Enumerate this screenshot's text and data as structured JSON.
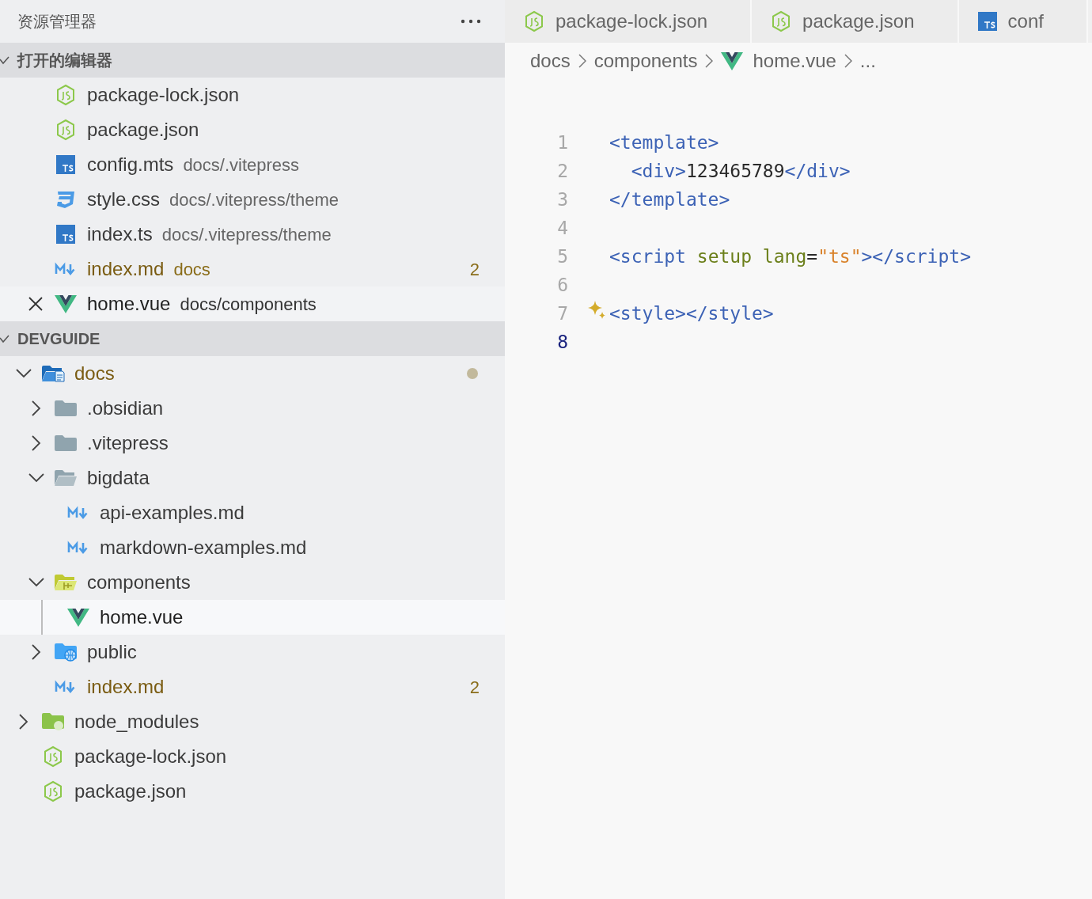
{
  "sidebar": {
    "title": "资源管理器",
    "sections": [
      {
        "title": "打开的编辑器",
        "expanded": true,
        "kind": "editors",
        "items": [
          {
            "name": "package-lock.json",
            "kind": "json",
            "modified": false,
            "selected": false
          },
          {
            "name": "package.json",
            "kind": "json",
            "modified": false,
            "selected": false
          },
          {
            "name": "config.mts",
            "path": "docs/.vitepress",
            "kind": "ts",
            "modified": false,
            "selected": false
          },
          {
            "name": "style.css",
            "path": "docs/.vitepress/theme",
            "kind": "css",
            "modified": false,
            "selected": false
          },
          {
            "name": "index.ts",
            "path": "docs/.vitepress/theme",
            "kind": "ts",
            "modified": false,
            "selected": false
          },
          {
            "name": "index.md",
            "path": "docs",
            "kind": "md",
            "modified": true,
            "badge": "2",
            "selected": false
          },
          {
            "name": "home.vue",
            "path": "docs/components",
            "kind": "vue",
            "modified": false,
            "selected": true
          }
        ]
      },
      {
        "title": "DEVGUIDE",
        "expanded": true,
        "kind": "tree",
        "items": [
          {
            "kind": "docs-folder",
            "name": "docs",
            "expanded": true,
            "modified": true,
            "dot": true,
            "selected": false,
            "children": [
              {
                "kind": "folder",
                "name": ".obsidian",
                "expanded": false,
                "modified": false,
                "selected": false
              },
              {
                "kind": "folder",
                "name": ".vitepress",
                "expanded": false,
                "modified": false,
                "selected": false
              },
              {
                "kind": "folder",
                "name": "bigdata",
                "expanded": true,
                "modified": false,
                "selected": false,
                "children": [
                  {
                    "kind": "md",
                    "name": "api-examples.md",
                    "modified": false,
                    "selected": false
                  },
                  {
                    "kind": "md",
                    "name": "markdown-examples.md",
                    "modified": false,
                    "selected": false
                  }
                ]
              },
              {
                "kind": "components-folder",
                "name": "components",
                "expanded": true,
                "modified": false,
                "selected": false,
                "children": [
                  {
                    "kind": "vue",
                    "name": "home.vue",
                    "modified": false,
                    "selected": true
                  }
                ]
              },
              {
                "kind": "public-folder",
                "name": "public",
                "expanded": false,
                "modified": false,
                "selected": false
              },
              {
                "kind": "md",
                "name": "index.md",
                "modified": true,
                "badge": "2",
                "selected": false
              }
            ]
          },
          {
            "kind": "node-folder",
            "name": "node_modules",
            "expanded": false,
            "modified": false,
            "selected": false
          },
          {
            "kind": "json",
            "name": "package-lock.json",
            "modified": false,
            "selected": false
          },
          {
            "kind": "json",
            "name": "package.json",
            "modified": false,
            "selected": false
          }
        ]
      }
    ]
  },
  "tabs": [
    {
      "label": "package-lock.json",
      "kind": "json",
      "selected": false
    },
    {
      "label": "package.json",
      "kind": "json",
      "selected": false
    },
    {
      "label": "conf",
      "kind": "ts",
      "selected": false
    }
  ],
  "breadcrumb": [
    {
      "label": "docs",
      "kind": "folder"
    },
    {
      "label": "components",
      "kind": "folder"
    },
    {
      "label": "home.vue",
      "kind": "vue"
    },
    {
      "label": "...",
      "kind": "symbol"
    }
  ],
  "editor": {
    "lines": [
      {
        "number": "1",
        "current": false,
        "tokens": [
          {
            "kind": "tag",
            "text": "<template>"
          }
        ]
      },
      {
        "number": "2",
        "current": false,
        "tokens": [
          {
            "kind": "tag",
            "text": "  <div>"
          },
          {
            "kind": "text",
            "text": "123465789"
          },
          {
            "kind": "tag",
            "text": "</div>"
          }
        ]
      },
      {
        "number": "3",
        "current": false,
        "tokens": [
          {
            "kind": "tag",
            "text": "</template>"
          }
        ]
      },
      {
        "number": "4",
        "current": false
      },
      {
        "number": "5",
        "current": false,
        "tokens": [
          {
            "kind": "tag",
            "text": "<script "
          },
          {
            "kind": "attr",
            "text": "setup lang"
          },
          {
            "kind": "text",
            "text": "="
          },
          {
            "kind": "string",
            "text": "\"ts\""
          },
          {
            "kind": "tag",
            "text": "></script>"
          }
        ]
      },
      {
        "number": "6",
        "current": false
      },
      {
        "number": "7",
        "current": false,
        "sparkle": true,
        "tokens": [
          {
            "kind": "tag",
            "text": "<style></style>"
          }
        ]
      },
      {
        "number": "8",
        "current": true
      }
    ]
  }
}
